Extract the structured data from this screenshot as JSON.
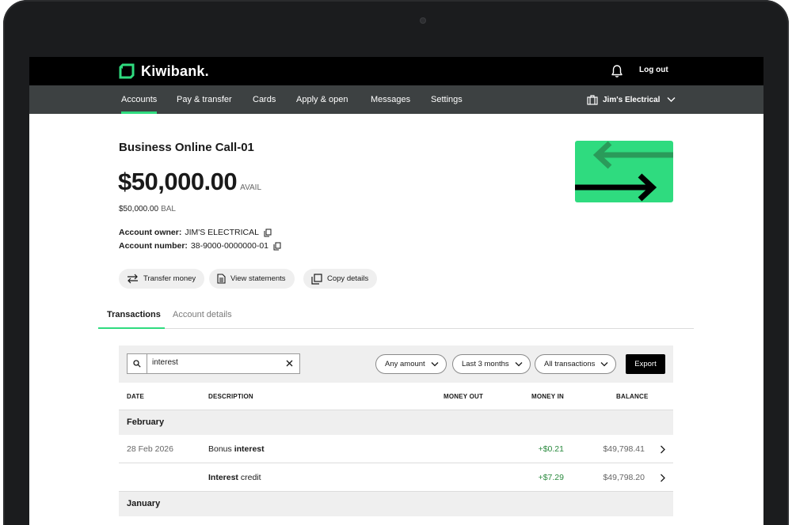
{
  "app": {
    "brand": "Kiwibank.",
    "brand_color": "#2fdb7f"
  },
  "topbar": {
    "logout_label": "Log out"
  },
  "nav": {
    "items": [
      {
        "label": "Accounts",
        "active": true
      },
      {
        "label": "Pay & transfer"
      },
      {
        "label": "Cards"
      },
      {
        "label": "Apply & open"
      },
      {
        "label": "Messages"
      },
      {
        "label": "Settings"
      }
    ],
    "business_name": "Jim's Electrical"
  },
  "account": {
    "name": "Business Online Call-01",
    "available": "$50,000.00",
    "available_label": "AVAIL",
    "balance": "$50,000.00",
    "balance_label": "BAL",
    "owner_label": "Account owner:",
    "owner": "JIM'S ELECTRICAL",
    "number_label": "Account number:",
    "number": "38-9000-0000000-01"
  },
  "actions": {
    "transfer": "Transfer money",
    "statements": "View statements",
    "copy": "Copy details"
  },
  "tabs": [
    {
      "label": "Transactions",
      "active": true
    },
    {
      "label": "Account details"
    }
  ],
  "filters": {
    "search_value": "interest",
    "amount": "Any amount",
    "period": "Last 3 months",
    "type": "All transactions",
    "export_label": "Export"
  },
  "table": {
    "headers": {
      "date": "DATE",
      "description": "DESCRIPTION",
      "money_out": "MONEY OUT",
      "money_in": "MONEY IN",
      "balance": "BALANCE"
    },
    "groups": [
      {
        "month": "February",
        "rows": [
          {
            "date": "28 Feb 2026",
            "desc_pre": "Bonus ",
            "desc_match": "interest",
            "desc_post": "",
            "money_in": "+$0.21",
            "balance": "$49,798.41"
          },
          {
            "date": "",
            "desc_pre": "",
            "desc_match": "Interest",
            "desc_post": " credit",
            "money_in": "+$7.29",
            "balance": "$49,798.20"
          }
        ]
      },
      {
        "month": "January",
        "rows": []
      }
    ]
  }
}
